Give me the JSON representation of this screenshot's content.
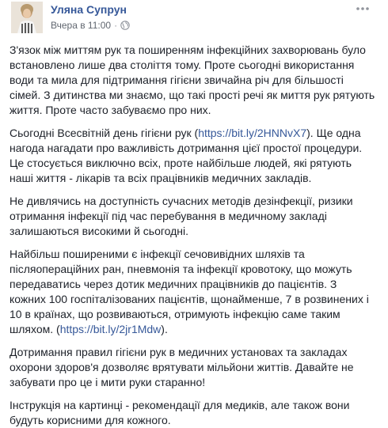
{
  "post": {
    "author": "Уляна Супрун",
    "timestamp": "Вчера в 11:00",
    "separator": "·",
    "privacy_icon": "globe-icon",
    "more_icon": "more-options-icon",
    "colors": {
      "author": "#365899",
      "link": "#365899",
      "text": "#1d2129",
      "meta": "#616770"
    }
  },
  "body": {
    "p1": "З'язок між миттям рук та поширенням інфекційних захворювань було встановлено лише два століття тому. Проте сьогодні використання води та мила для підтримання гігієни звичайна річ для більшості сімей. З дитинства ми знаємо, що такі прості речі як миття рук рятують життя. Проте часто забуваємо про них.",
    "p2_before": "Сьогодні Всесвітній день гігієни рук (",
    "p2_link": "https://bit.ly/2HNNvX7",
    "p2_after": "). Ще одна нагода нагадати про важливість дотримання цієї простої процедури. Це стосується виключно всіх, проте найбільше людей, які рятують наші життя - лікарів та всіх працівників медичних закладів.",
    "p3": "Не дивлячись на доступність сучасних методів дезінфекції, ризики отримання інфекції під час перебування в медичному закладі залишаються високими й сьогодні.",
    "p4_before": "Найбільш поширеними є інфекції сечовивідних шляхів та післяопераційних ран, пневмонія та інфекції кровотоку, що можуть передаватись через дотик медичних працівників до пацієнтів. З кожних 100 госпіталізованих пацієнтів, щонайменше, 7 в розвинених і 10 в країнах, що розвиваються, отримують інфекцію саме таким шляхом. (",
    "p4_link": "https://bit.ly/2jr1Mdw",
    "p4_after": ").",
    "p5": "Дотримання правил гігієни рук в медичних установах та закладах охорони здоров'я дозволяє врятувати мільйони життів. Давайте не забувати про це і мити руки старанно!",
    "p6": "Інструкція на картинці - рекомендації для медиків, але також вони будуть корисними для кожного."
  }
}
